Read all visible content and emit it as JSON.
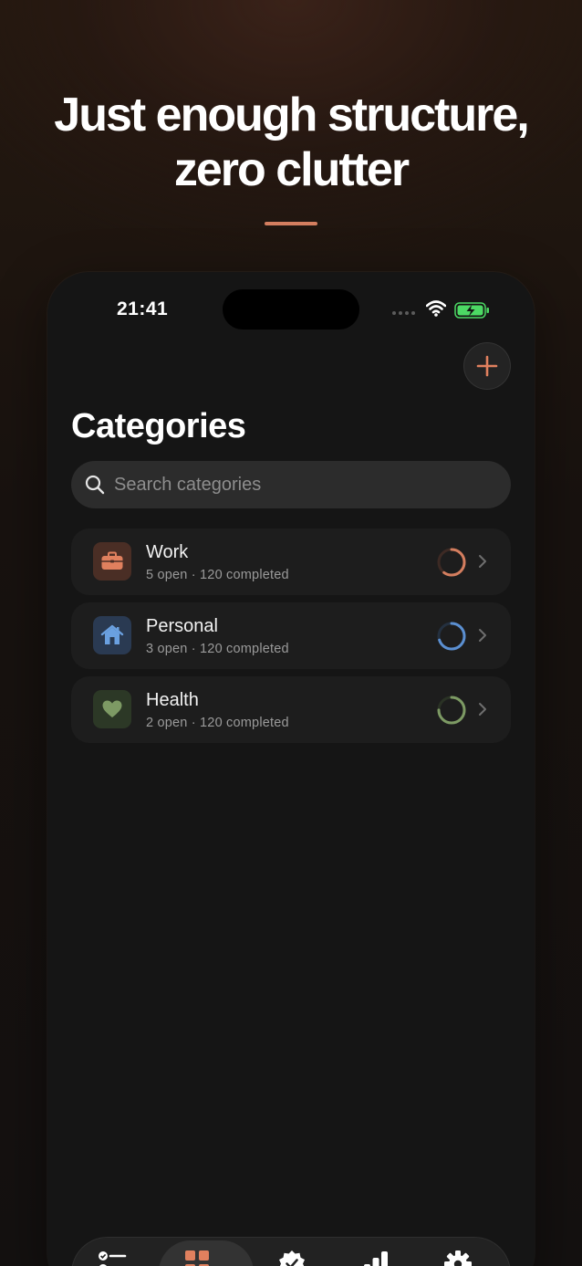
{
  "headline": {
    "line1": "Just enough structure,",
    "line2": "zero clutter"
  },
  "status_bar": {
    "time": "21:41"
  },
  "colors": {
    "accent": "#d47e5f",
    "work": "#d47e5f",
    "personal": "#5b8fd1",
    "health": "#7d9a64"
  },
  "header": {
    "title": "Categories",
    "add_icon": "plus-icon"
  },
  "search": {
    "placeholder": "Search categories",
    "icon": "search-icon"
  },
  "categories": [
    {
      "name": "Work",
      "meta": "5 open · 120 completed",
      "icon": "briefcase-icon",
      "color": "#d47e5f",
      "progress": 0.6
    },
    {
      "name": "Personal",
      "meta": "3 open · 120 completed",
      "icon": "house-icon",
      "color": "#5b8fd1",
      "progress": 0.7
    },
    {
      "name": "Health",
      "meta": "2 open · 120 completed",
      "icon": "heart-icon",
      "color": "#7d9a64",
      "progress": 0.75
    }
  ],
  "tab_bar": {
    "tabs": [
      {
        "icon": "checklist-icon",
        "active": false
      },
      {
        "icon": "grid-icon",
        "active": true
      },
      {
        "icon": "badge-check-icon",
        "active": false
      },
      {
        "icon": "bar-chart-icon",
        "active": false
      },
      {
        "icon": "gear-icon",
        "active": false
      }
    ]
  }
}
